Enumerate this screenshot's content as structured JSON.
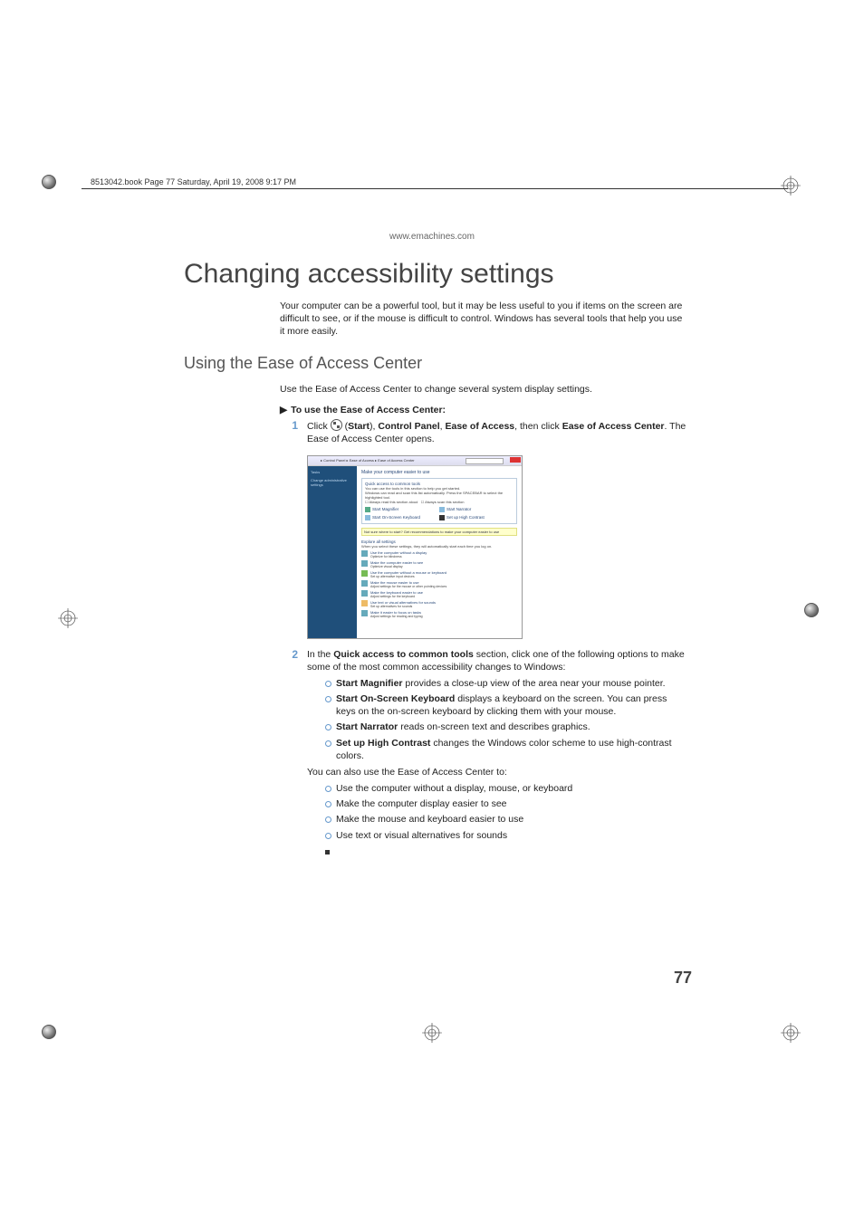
{
  "meta": {
    "header_text": "8513042.book  Page 77  Saturday, April 19, 2008  9:17 PM",
    "site_url": "www.emachines.com",
    "page_number": "77"
  },
  "content": {
    "title": "Changing accessibility settings",
    "intro": "Your computer can be a powerful tool, but it may be less useful to you if items on the screen are difficult to see, or if the mouse is difficult to control. Windows has several tools that help you use it more easily.",
    "subheading": "Using the Ease of Access Center",
    "sub_intro": "Use the Ease of Access Center to change several system display settings.",
    "proc_title": "To use the Ease of Access Center:",
    "step1": {
      "num": "1",
      "prefix": "Click ",
      "start": "Start",
      "sep1": "), ",
      "cp": "Control Panel",
      "sep2": ", ",
      "eoa": "Ease of Access",
      "sep3": ", then click ",
      "eoac": "Ease of Access Center",
      "suffix": ". The Ease of Access Center opens."
    },
    "step2": {
      "num": "2",
      "prefix": "In the ",
      "qa": "Quick access to common tools",
      "suffix": " section, click one of the following options to make some of the most common accessibility changes to Windows:",
      "bullets": [
        {
          "b": "Start Magnifier",
          "t": " provides a close-up view of the area near your mouse pointer."
        },
        {
          "b": "Start On-Screen Keyboard",
          "t": " displays a keyboard on the screen. You can press keys on the on-screen keyboard by clicking them with your mouse."
        },
        {
          "b": "Start Narrator",
          "t": " reads on-screen text and describes graphics."
        },
        {
          "b": "Set up High Contrast",
          "t": " changes the Windows color scheme to use high-contrast colors."
        }
      ],
      "after_bullets": "You can also use the Ease of Access Center to:",
      "more": [
        "Use the computer without a display, mouse, or keyboard",
        "Make the computer display easier to see",
        "Make the mouse and keyboard easier to use",
        "Use text or visual alternatives for sounds"
      ]
    }
  },
  "screenshot": {
    "crumb": "▸ Control Panel ▸ Ease of Access ▸ Ease of Access Center",
    "side": {
      "tasks": "Tasks",
      "link": "Change administrative settings"
    },
    "main_heading": "Make your computer easier to use",
    "qa_title": "Quick access to common tools",
    "qa_text1": "You can use the tools in this section to help you get started.",
    "qa_text2": "Windows can read and scan this list automatically. Press the SPACEBAR to select the highlighted tool.",
    "cb1": "Always read this section aloud",
    "cb2": "Always scan this section",
    "cmd_magnifier": "Start Magnifier",
    "cmd_narrator": "Start Narrator",
    "cmd_osk": "Start On-Screen Keyboard",
    "cmd_hc": "Set up High Contrast",
    "yellow": "Not sure where to start? Get recommendations to make your computer easier to use",
    "explore_h": "Explore all settings",
    "explore_sub": "When you select these settings, they will automatically start each time you log on.",
    "links": [
      {
        "t1": "Use the computer without a display",
        "t2": "Optimize for blindness"
      },
      {
        "t1": "Make the computer easier to see",
        "t2": "Optimize visual display"
      },
      {
        "t1": "Use the computer without a mouse or keyboard",
        "t2": "Set up alternative input devices"
      },
      {
        "t1": "Make the mouse easier to use",
        "t2": "Adjust settings for the mouse or other pointing devices"
      },
      {
        "t1": "Make the keyboard easier to use",
        "t2": "Adjust settings for the keyboard"
      },
      {
        "t1": "Use text or visual alternatives for sounds",
        "t2": "Set up alternatives for sounds"
      },
      {
        "t1": "Make it easier to focus on tasks",
        "t2": "Adjust settings for reading and typing"
      }
    ]
  }
}
